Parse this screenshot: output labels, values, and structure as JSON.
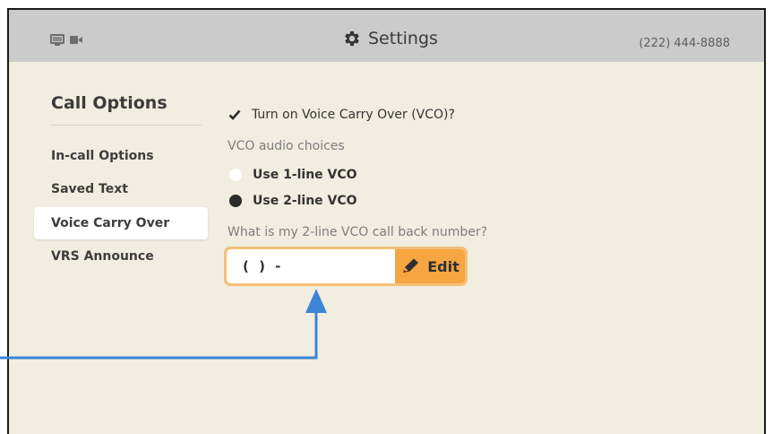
{
  "header": {
    "title": "Settings",
    "phone": "(222) 444-8888",
    "icons": [
      "screen-share-icon",
      "video-camera-icon",
      "gear-icon"
    ]
  },
  "sidebar": {
    "title": "Call Options",
    "items": [
      {
        "label": "In-call Options",
        "active": false
      },
      {
        "label": "Saved Text",
        "active": false
      },
      {
        "label": "Voice Carry Over",
        "active": true
      },
      {
        "label": "VRS Announce",
        "active": false
      }
    ]
  },
  "vco": {
    "toggle_label": "Turn on Voice Carry Over (VCO)?",
    "toggle_checked": true,
    "choices_label": "VCO audio choices",
    "options": [
      {
        "label": "Use 1-line VCO",
        "selected": false
      },
      {
        "label": "Use 2-line VCO",
        "selected": true
      }
    ],
    "callback_question": "What is my 2-line VCO call back number?",
    "callback_value": "( ) -",
    "edit_label": "Edit"
  },
  "colors": {
    "topbar": "#cbcbcb",
    "background": "#f2ede1",
    "field_border": "#f6c078",
    "edit_button": "#f7a541",
    "callout_arrow": "#3b86d4"
  }
}
